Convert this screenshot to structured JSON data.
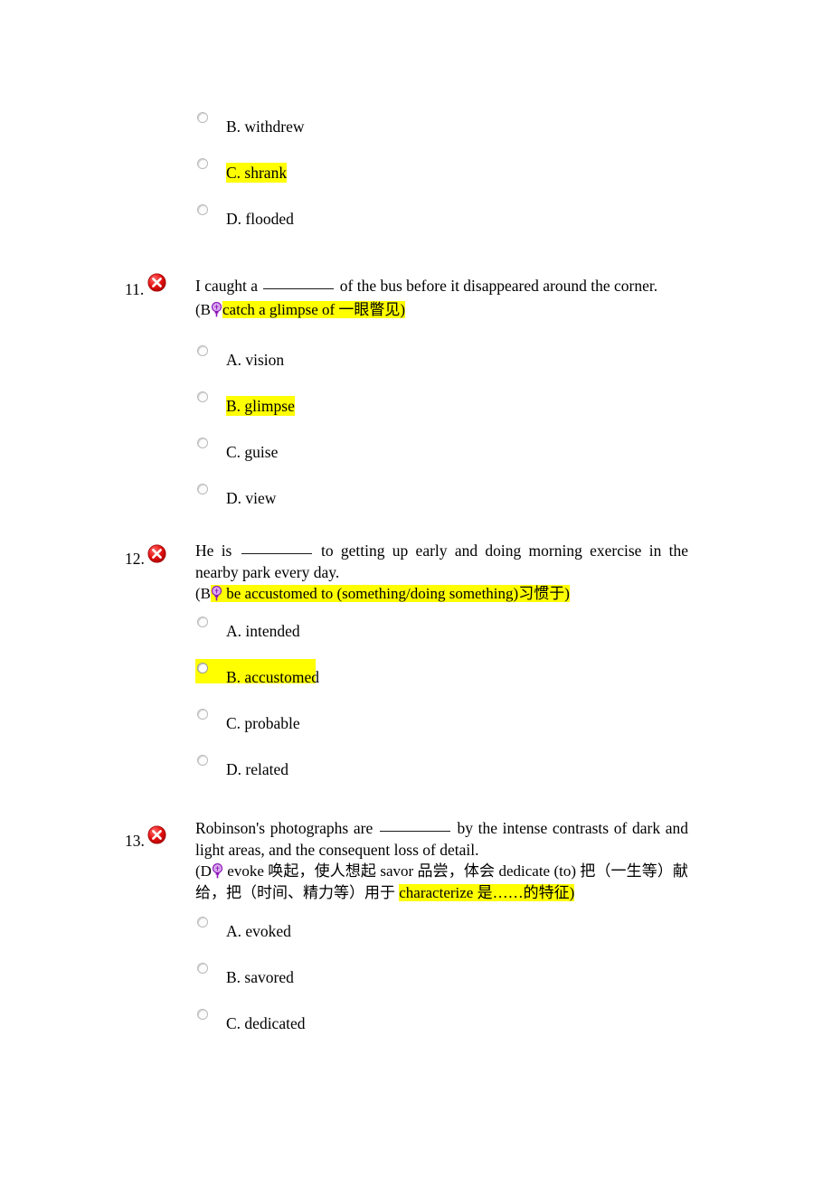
{
  "page": {
    "background": "#ffffff",
    "highlight_color": "#ffff00",
    "incorrect_icon_color": "#e01b1b",
    "hint_icon_color": "#a020c0"
  },
  "top_options": {
    "name": "continued-options-previous-question",
    "items": [
      {
        "label": "B. withdrew",
        "highlighted": false,
        "selected": false
      },
      {
        "label": "C. shrank",
        "highlighted": true,
        "selected": false
      },
      {
        "label": "D. flooded",
        "highlighted": false,
        "selected": false
      }
    ]
  },
  "questions": [
    {
      "number": "11.",
      "status_icon": "error-circle-icon",
      "stem_before": "I caught a ",
      "stem_after": " of the bus before it disappeared around the corner.",
      "hint_prefix": "(B",
      "hint_icon": "lightbulb-icon",
      "hint_highlighted_text": "catch a glimpse of  一眼瞥见)",
      "hint_suffix": "",
      "options": [
        {
          "label": "A. vision",
          "highlighted": false,
          "band": false
        },
        {
          "label": "B. glimpse",
          "highlighted": true,
          "band": false
        },
        {
          "label": "C. guise",
          "highlighted": false,
          "band": false
        },
        {
          "label": "D. view",
          "highlighted": false,
          "band": false
        }
      ]
    },
    {
      "number": "12.",
      "status_icon": "error-circle-icon",
      "stem_before": "He is ",
      "stem_after": " to getting up early and doing morning exercise in the nearby park every day.",
      "hint_prefix": "(B",
      "hint_icon": "lightbulb-icon",
      "hint_highlighted_text": " be accustomed to (something/doing something)习惯于)",
      "hint_suffix": "",
      "options": [
        {
          "label": "A. intended",
          "highlighted": false,
          "band": false
        },
        {
          "label": "B. accustomed",
          "highlighted": true,
          "band": true
        },
        {
          "label": "C. probable",
          "highlighted": false,
          "band": false
        },
        {
          "label": "D. related",
          "highlighted": false,
          "band": false
        }
      ]
    },
    {
      "number": "13.",
      "status_icon": "error-circle-icon",
      "stem_before": "Robinson's photographs are ",
      "stem_after": " by the intense contrasts of dark and light areas, and the consequent loss of detail.",
      "hint_prefix": "(D",
      "hint_icon": "lightbulb-icon",
      "hint_plain_text": " evoke 唤起，使人想起 savor 品尝，体会 dedicate (to) 把（一生等）献给，把（时间、精力等）用于 ",
      "hint_highlighted_text": "characterize 是……的特征)",
      "options": [
        {
          "label": "A. evoked",
          "highlighted": false,
          "band": false
        },
        {
          "label": "B. savored",
          "highlighted": false,
          "band": false
        },
        {
          "label": "C. dedicated",
          "highlighted": false,
          "band": false
        }
      ]
    }
  ]
}
